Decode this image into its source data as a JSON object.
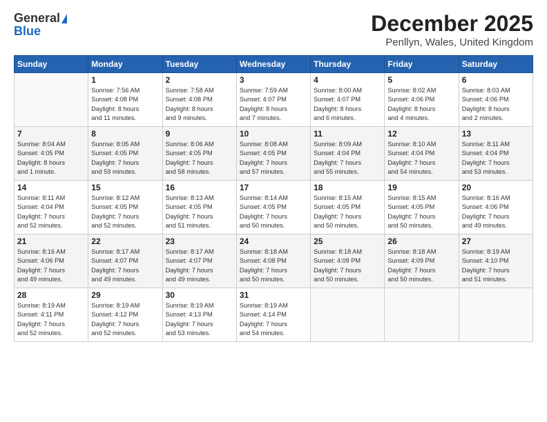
{
  "logo": {
    "line1": "General",
    "line2": "Blue"
  },
  "title": "December 2025",
  "location": "Penllyn, Wales, United Kingdom",
  "weekdays": [
    "Sunday",
    "Monday",
    "Tuesday",
    "Wednesday",
    "Thursday",
    "Friday",
    "Saturday"
  ],
  "weeks": [
    [
      {
        "day": "",
        "info": ""
      },
      {
        "day": "1",
        "info": "Sunrise: 7:56 AM\nSunset: 4:08 PM\nDaylight: 8 hours\nand 11 minutes."
      },
      {
        "day": "2",
        "info": "Sunrise: 7:58 AM\nSunset: 4:08 PM\nDaylight: 8 hours\nand 9 minutes."
      },
      {
        "day": "3",
        "info": "Sunrise: 7:59 AM\nSunset: 4:07 PM\nDaylight: 8 hours\nand 7 minutes."
      },
      {
        "day": "4",
        "info": "Sunrise: 8:00 AM\nSunset: 4:07 PM\nDaylight: 8 hours\nand 6 minutes."
      },
      {
        "day": "5",
        "info": "Sunrise: 8:02 AM\nSunset: 4:06 PM\nDaylight: 8 hours\nand 4 minutes."
      },
      {
        "day": "6",
        "info": "Sunrise: 8:03 AM\nSunset: 4:06 PM\nDaylight: 8 hours\nand 2 minutes."
      }
    ],
    [
      {
        "day": "7",
        "info": "Sunrise: 8:04 AM\nSunset: 4:05 PM\nDaylight: 8 hours\nand 1 minute."
      },
      {
        "day": "8",
        "info": "Sunrise: 8:05 AM\nSunset: 4:05 PM\nDaylight: 7 hours\nand 59 minutes."
      },
      {
        "day": "9",
        "info": "Sunrise: 8:06 AM\nSunset: 4:05 PM\nDaylight: 7 hours\nand 58 minutes."
      },
      {
        "day": "10",
        "info": "Sunrise: 8:08 AM\nSunset: 4:05 PM\nDaylight: 7 hours\nand 57 minutes."
      },
      {
        "day": "11",
        "info": "Sunrise: 8:09 AM\nSunset: 4:04 PM\nDaylight: 7 hours\nand 55 minutes."
      },
      {
        "day": "12",
        "info": "Sunrise: 8:10 AM\nSunset: 4:04 PM\nDaylight: 7 hours\nand 54 minutes."
      },
      {
        "day": "13",
        "info": "Sunrise: 8:11 AM\nSunset: 4:04 PM\nDaylight: 7 hours\nand 53 minutes."
      }
    ],
    [
      {
        "day": "14",
        "info": "Sunrise: 8:11 AM\nSunset: 4:04 PM\nDaylight: 7 hours\nand 52 minutes."
      },
      {
        "day": "15",
        "info": "Sunrise: 8:12 AM\nSunset: 4:05 PM\nDaylight: 7 hours\nand 52 minutes."
      },
      {
        "day": "16",
        "info": "Sunrise: 8:13 AM\nSunset: 4:05 PM\nDaylight: 7 hours\nand 51 minutes."
      },
      {
        "day": "17",
        "info": "Sunrise: 8:14 AM\nSunset: 4:05 PM\nDaylight: 7 hours\nand 50 minutes."
      },
      {
        "day": "18",
        "info": "Sunrise: 8:15 AM\nSunset: 4:05 PM\nDaylight: 7 hours\nand 50 minutes."
      },
      {
        "day": "19",
        "info": "Sunrise: 8:15 AM\nSunset: 4:05 PM\nDaylight: 7 hours\nand 50 minutes."
      },
      {
        "day": "20",
        "info": "Sunrise: 8:16 AM\nSunset: 4:06 PM\nDaylight: 7 hours\nand 49 minutes."
      }
    ],
    [
      {
        "day": "21",
        "info": "Sunrise: 8:16 AM\nSunset: 4:06 PM\nDaylight: 7 hours\nand 49 minutes."
      },
      {
        "day": "22",
        "info": "Sunrise: 8:17 AM\nSunset: 4:07 PM\nDaylight: 7 hours\nand 49 minutes."
      },
      {
        "day": "23",
        "info": "Sunrise: 8:17 AM\nSunset: 4:07 PM\nDaylight: 7 hours\nand 49 minutes."
      },
      {
        "day": "24",
        "info": "Sunrise: 8:18 AM\nSunset: 4:08 PM\nDaylight: 7 hours\nand 50 minutes."
      },
      {
        "day": "25",
        "info": "Sunrise: 8:18 AM\nSunset: 4:09 PM\nDaylight: 7 hours\nand 50 minutes."
      },
      {
        "day": "26",
        "info": "Sunrise: 8:18 AM\nSunset: 4:09 PM\nDaylight: 7 hours\nand 50 minutes."
      },
      {
        "day": "27",
        "info": "Sunrise: 8:19 AM\nSunset: 4:10 PM\nDaylight: 7 hours\nand 51 minutes."
      }
    ],
    [
      {
        "day": "28",
        "info": "Sunrise: 8:19 AM\nSunset: 4:11 PM\nDaylight: 7 hours\nand 52 minutes."
      },
      {
        "day": "29",
        "info": "Sunrise: 8:19 AM\nSunset: 4:12 PM\nDaylight: 7 hours\nand 52 minutes."
      },
      {
        "day": "30",
        "info": "Sunrise: 8:19 AM\nSunset: 4:13 PM\nDaylight: 7 hours\nand 53 minutes."
      },
      {
        "day": "31",
        "info": "Sunrise: 8:19 AM\nSunset: 4:14 PM\nDaylight: 7 hours\nand 54 minutes."
      },
      {
        "day": "",
        "info": ""
      },
      {
        "day": "",
        "info": ""
      },
      {
        "day": "",
        "info": ""
      }
    ]
  ]
}
